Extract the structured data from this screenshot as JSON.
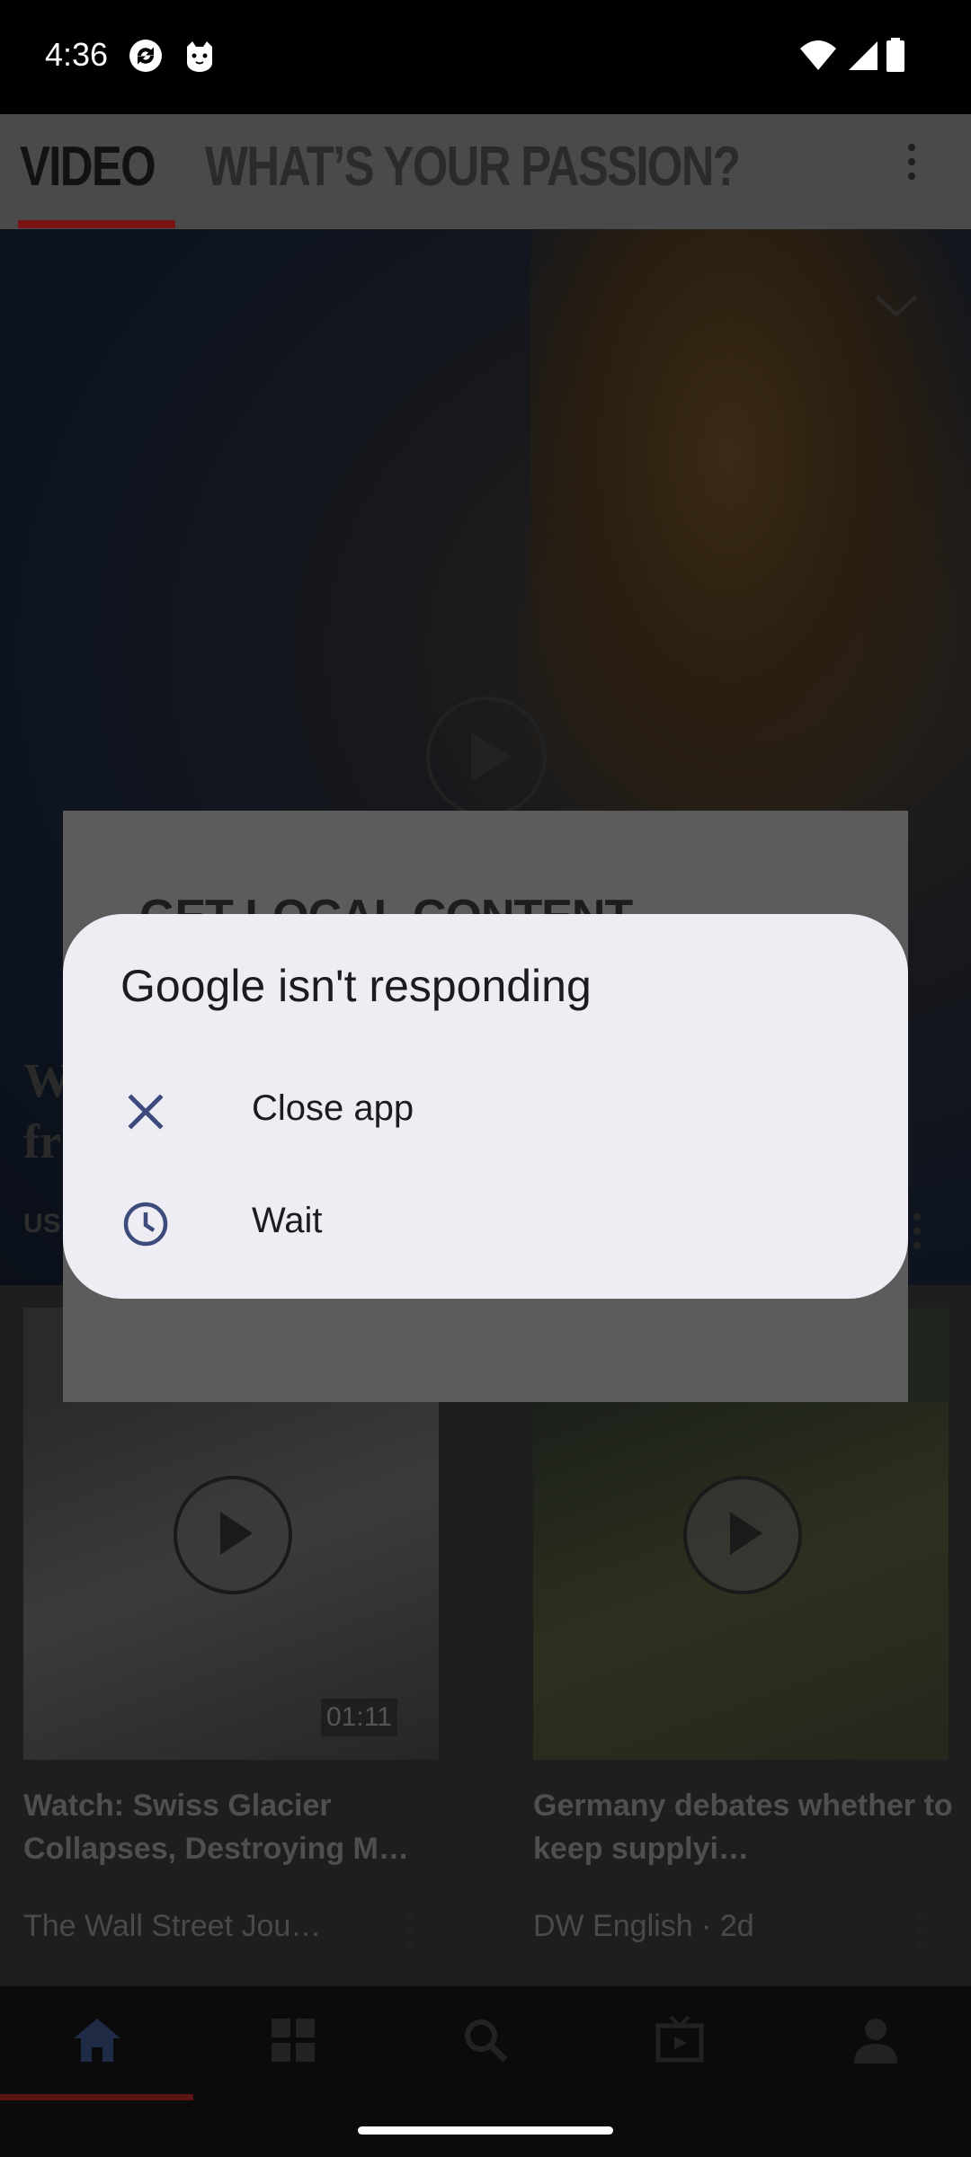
{
  "status_bar": {
    "time": "4:36",
    "icons": [
      "sync-icon",
      "cat-face-icon",
      "wifi-icon",
      "signal-icon",
      "battery-icon"
    ]
  },
  "app_bar": {
    "tabs": [
      {
        "label": "VIDEO",
        "selected": true
      },
      {
        "label": "WHAT’S YOUR PASSION?",
        "selected": false
      }
    ]
  },
  "hero": {
    "headline_line1": "W",
    "headline_line2": "fr",
    "source": "US"
  },
  "background_dialog": {
    "title": "GET LOCAL CONTENT"
  },
  "cards": [
    {
      "title": "Watch: Swiss Glacier Collapses, Destroying M…",
      "meta": "The Wall Street Jou…",
      "duration": "01:11"
    },
    {
      "title": "Germany debates whether to keep supplyi…",
      "meta": "DW English · 2d"
    }
  ],
  "bottom_nav": {
    "items": [
      "home-icon",
      "grid-icon",
      "search-icon",
      "tv-icon",
      "profile-icon"
    ],
    "selected": "home-icon"
  },
  "anr_dialog": {
    "title": "Google isn't responding",
    "options": [
      {
        "label": "Close app",
        "icon": "close-icon"
      },
      {
        "label": "Wait",
        "icon": "clock-icon"
      }
    ]
  },
  "colors": {
    "dialog_bg": "#efedf4",
    "dialog_icon": "#3c4a7c",
    "accent_red": "#7a1414"
  }
}
